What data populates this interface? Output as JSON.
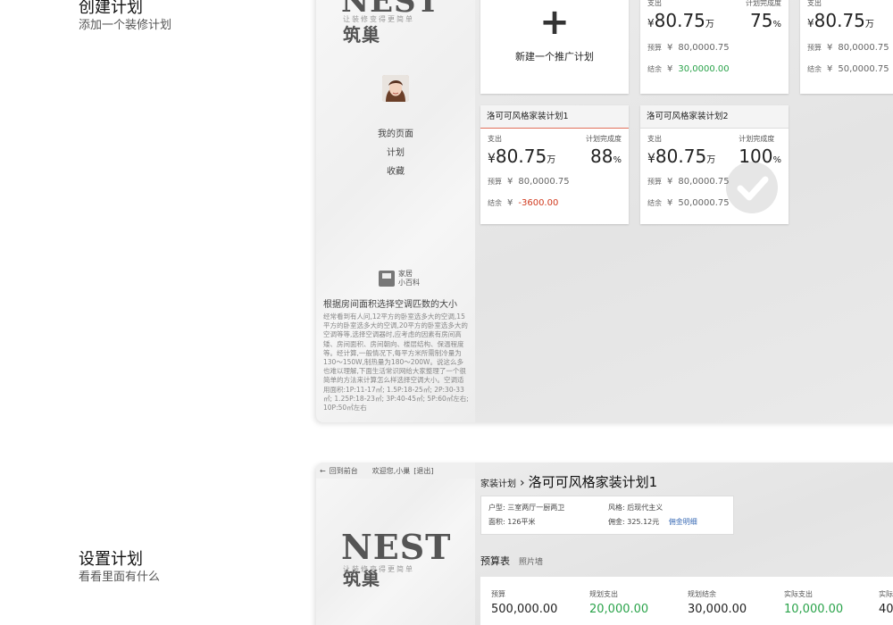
{
  "sections": [
    {
      "title": "创建计划",
      "subtitle": "添加一个装修计划"
    },
    {
      "title": "设置计划",
      "subtitle": "看看里面有什么"
    }
  ],
  "brand": {
    "logo_text": "NEST",
    "logo_cn": "筑巢",
    "slogan": "让装修变得更简单"
  },
  "sidebar": {
    "nav": [
      "我的页面",
      "计划",
      "收藏"
    ],
    "wiki_label_1": "家居",
    "wiki_label_2": "小百科",
    "article_title": "根据房间面积选择空调匹数的大小",
    "article_body": "经常看到有人问,12平方的卧室选多大的空调,15平方的卧室选多大的空调,20平方的卧室选多大的空调等等,选择空调器时,应考虑的因素有房间高矮、房间面积、房间朝向、楼层结构、保温程度等。经计算,一般情况下,每平方米所需制冷量为130～150W,制热量为180～200W。说这么多也难以理解,下面生活常识网给大家整理了一个很简单的方法来计算怎么样选择空调大小。空调适用面积:1P:11-17㎡; 1.5P:18-25㎡; 2P:30-33㎡; 1.25P:18-23㎡; 3P:40-45㎡; 5P:60㎡左右; 10P:50㎡左右"
  },
  "new_plan": {
    "label": "新建一个推广计划"
  },
  "labels": {
    "spend": "支出",
    "completion": "计划完成度",
    "budget": "预算",
    "balance": "结余",
    "currency": "¥",
    "unit": "万",
    "pct": "%"
  },
  "plans": [
    {
      "name": "",
      "spend": "80.75",
      "completion": "75",
      "budget": "80,0000.75",
      "balance": "30,0000.00",
      "balance_status": "positive"
    },
    {
      "name": "",
      "spend": "80.75",
      "completion": "",
      "budget": "80,0000.75",
      "balance": "50,0000.75",
      "balance_status": "neutral"
    },
    {
      "name": "洛可可风格家装计划1",
      "spend": "80.75",
      "completion": "88",
      "budget": "80,0000.75",
      "balance": "-3600.00",
      "balance_status": "negative"
    },
    {
      "name": "洛可可风格家装计划2",
      "spend": "80.75",
      "completion": "100",
      "budget": "80,0000.75",
      "balance": "50,0000.75",
      "balance_status": "neutral",
      "complete": true
    }
  ],
  "detail": {
    "back": "回到前台",
    "welcome": "欢迎您,小巢",
    "logout": "[退出]",
    "crumb_parent": "家装计划",
    "crumb_sep": "›",
    "plan_title": "洛可可风格家装计划1",
    "info": {
      "layout_label": "户型:",
      "layout": "三室两厅一厨两卫",
      "style_label": "风格:",
      "style": "后现代主义",
      "area_label": "面积:",
      "area": "126平米",
      "commission_label": "佣金:",
      "commission": "325.12元",
      "commission_link": "佣金明细"
    },
    "tabs": [
      "预算表",
      "照片墙"
    ],
    "budget_cols": [
      {
        "label": "预算",
        "value": "500,000.00",
        "color": "#222222"
      },
      {
        "label": "规划支出",
        "value": "20,000.00",
        "color": "#2aa34a"
      },
      {
        "label": "规划结余",
        "value": "30,000.00",
        "color": "#222222"
      },
      {
        "label": "实际支出",
        "value": "10,000.00",
        "color": "#2aa34a"
      },
      {
        "label": "实际",
        "value": "40",
        "color": "#222222"
      }
    ]
  },
  "colors": {
    "positive": "#2aa34a",
    "negative": "#d0391d",
    "accent_line": "#e0705a"
  }
}
